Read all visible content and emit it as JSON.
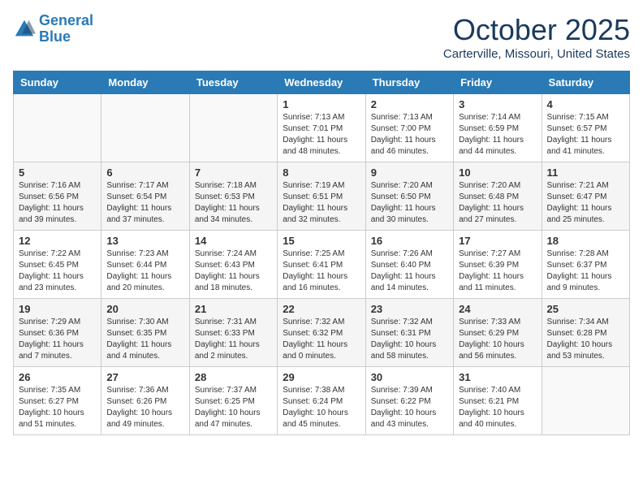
{
  "header": {
    "logo_line1": "General",
    "logo_line2": "Blue",
    "month_title": "October 2025",
    "location": "Carterville, Missouri, United States"
  },
  "weekdays": [
    "Sunday",
    "Monday",
    "Tuesday",
    "Wednesday",
    "Thursday",
    "Friday",
    "Saturday"
  ],
  "weeks": [
    [
      {
        "day": "",
        "info": ""
      },
      {
        "day": "",
        "info": ""
      },
      {
        "day": "",
        "info": ""
      },
      {
        "day": "1",
        "info": "Sunrise: 7:13 AM\nSunset: 7:01 PM\nDaylight: 11 hours\nand 48 minutes."
      },
      {
        "day": "2",
        "info": "Sunrise: 7:13 AM\nSunset: 7:00 PM\nDaylight: 11 hours\nand 46 minutes."
      },
      {
        "day": "3",
        "info": "Sunrise: 7:14 AM\nSunset: 6:59 PM\nDaylight: 11 hours\nand 44 minutes."
      },
      {
        "day": "4",
        "info": "Sunrise: 7:15 AM\nSunset: 6:57 PM\nDaylight: 11 hours\nand 41 minutes."
      }
    ],
    [
      {
        "day": "5",
        "info": "Sunrise: 7:16 AM\nSunset: 6:56 PM\nDaylight: 11 hours\nand 39 minutes."
      },
      {
        "day": "6",
        "info": "Sunrise: 7:17 AM\nSunset: 6:54 PM\nDaylight: 11 hours\nand 37 minutes."
      },
      {
        "day": "7",
        "info": "Sunrise: 7:18 AM\nSunset: 6:53 PM\nDaylight: 11 hours\nand 34 minutes."
      },
      {
        "day": "8",
        "info": "Sunrise: 7:19 AM\nSunset: 6:51 PM\nDaylight: 11 hours\nand 32 minutes."
      },
      {
        "day": "9",
        "info": "Sunrise: 7:20 AM\nSunset: 6:50 PM\nDaylight: 11 hours\nand 30 minutes."
      },
      {
        "day": "10",
        "info": "Sunrise: 7:20 AM\nSunset: 6:48 PM\nDaylight: 11 hours\nand 27 minutes."
      },
      {
        "day": "11",
        "info": "Sunrise: 7:21 AM\nSunset: 6:47 PM\nDaylight: 11 hours\nand 25 minutes."
      }
    ],
    [
      {
        "day": "12",
        "info": "Sunrise: 7:22 AM\nSunset: 6:45 PM\nDaylight: 11 hours\nand 23 minutes."
      },
      {
        "day": "13",
        "info": "Sunrise: 7:23 AM\nSunset: 6:44 PM\nDaylight: 11 hours\nand 20 minutes."
      },
      {
        "day": "14",
        "info": "Sunrise: 7:24 AM\nSunset: 6:43 PM\nDaylight: 11 hours\nand 18 minutes."
      },
      {
        "day": "15",
        "info": "Sunrise: 7:25 AM\nSunset: 6:41 PM\nDaylight: 11 hours\nand 16 minutes."
      },
      {
        "day": "16",
        "info": "Sunrise: 7:26 AM\nSunset: 6:40 PM\nDaylight: 11 hours\nand 14 minutes."
      },
      {
        "day": "17",
        "info": "Sunrise: 7:27 AM\nSunset: 6:39 PM\nDaylight: 11 hours\nand 11 minutes."
      },
      {
        "day": "18",
        "info": "Sunrise: 7:28 AM\nSunset: 6:37 PM\nDaylight: 11 hours\nand 9 minutes."
      }
    ],
    [
      {
        "day": "19",
        "info": "Sunrise: 7:29 AM\nSunset: 6:36 PM\nDaylight: 11 hours\nand 7 minutes."
      },
      {
        "day": "20",
        "info": "Sunrise: 7:30 AM\nSunset: 6:35 PM\nDaylight: 11 hours\nand 4 minutes."
      },
      {
        "day": "21",
        "info": "Sunrise: 7:31 AM\nSunset: 6:33 PM\nDaylight: 11 hours\nand 2 minutes."
      },
      {
        "day": "22",
        "info": "Sunrise: 7:32 AM\nSunset: 6:32 PM\nDaylight: 11 hours\nand 0 minutes."
      },
      {
        "day": "23",
        "info": "Sunrise: 7:32 AM\nSunset: 6:31 PM\nDaylight: 10 hours\nand 58 minutes."
      },
      {
        "day": "24",
        "info": "Sunrise: 7:33 AM\nSunset: 6:29 PM\nDaylight: 10 hours\nand 56 minutes."
      },
      {
        "day": "25",
        "info": "Sunrise: 7:34 AM\nSunset: 6:28 PM\nDaylight: 10 hours\nand 53 minutes."
      }
    ],
    [
      {
        "day": "26",
        "info": "Sunrise: 7:35 AM\nSunset: 6:27 PM\nDaylight: 10 hours\nand 51 minutes."
      },
      {
        "day": "27",
        "info": "Sunrise: 7:36 AM\nSunset: 6:26 PM\nDaylight: 10 hours\nand 49 minutes."
      },
      {
        "day": "28",
        "info": "Sunrise: 7:37 AM\nSunset: 6:25 PM\nDaylight: 10 hours\nand 47 minutes."
      },
      {
        "day": "29",
        "info": "Sunrise: 7:38 AM\nSunset: 6:24 PM\nDaylight: 10 hours\nand 45 minutes."
      },
      {
        "day": "30",
        "info": "Sunrise: 7:39 AM\nSunset: 6:22 PM\nDaylight: 10 hours\nand 43 minutes."
      },
      {
        "day": "31",
        "info": "Sunrise: 7:40 AM\nSunset: 6:21 PM\nDaylight: 10 hours\nand 40 minutes."
      },
      {
        "day": "",
        "info": ""
      }
    ]
  ]
}
